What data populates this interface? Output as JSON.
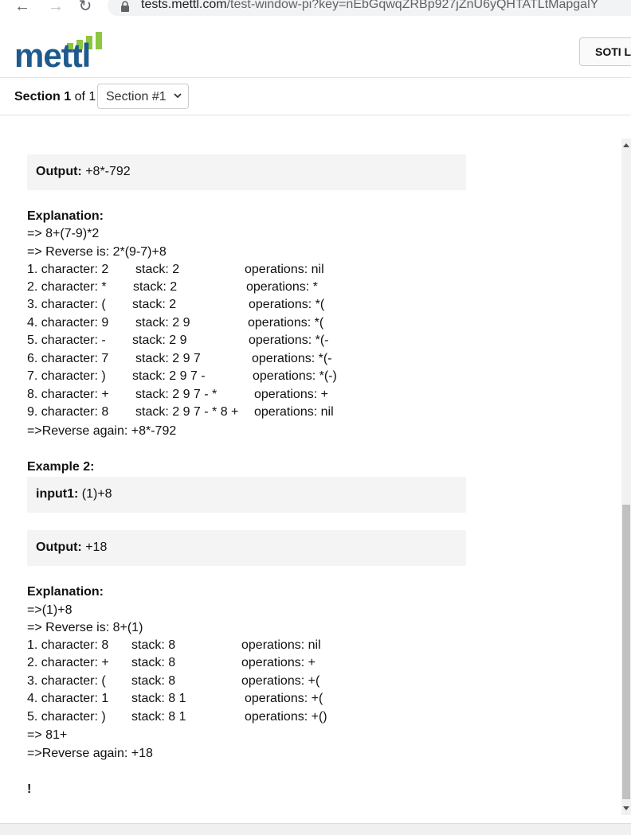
{
  "browser": {
    "back_icon": "arrow-left-icon",
    "forward_icon": "arrow-right-icon",
    "reload_icon": "reload-icon",
    "url_host": "tests.mettl.com",
    "url_path": "/test-window-pi?key=nEbGqwqZRBp927jZnU6yQHTATLtMapgalY"
  },
  "header": {
    "logo_text": "mettl",
    "user_button_label": "SOTI L",
    "brand_color": "#1e5a8d",
    "accent_color": "#8dc63f"
  },
  "section_bar": {
    "prefix": "Section",
    "current": "1",
    "of_label": "of 1",
    "selected": "Section #1"
  },
  "content": {
    "output1_label": "Output:",
    "output1_value": "+8*-792",
    "explanation1_label": "Explanation:",
    "explanation1_lines": [
      "=> 8+(7-9)*2",
      "=> Reverse is: 2*(9-7)+8"
    ],
    "steps1": [
      {
        "char": "1. character: 2",
        "stack": "stack: 2",
        "ops": "operations: nil"
      },
      {
        "char": "2. character: *",
        "stack": "stack: 2",
        "ops": "operations: *"
      },
      {
        "char": "3. character: (",
        "stack": "stack: 2",
        "ops": "operations: *("
      },
      {
        "char": "4. character: 9",
        "stack": "stack: 2 9",
        "ops": "operations: *("
      },
      {
        "char": "5. character: -",
        "stack": "stack: 2 9",
        "ops": "operations: *(-"
      },
      {
        "char": "6. character: 7",
        "stack": "stack: 2 9 7",
        "ops": "operations: *(-"
      },
      {
        "char": "7. character: )",
        "stack": "stack: 2 9 7 -",
        "ops": "operations: *(-)"
      },
      {
        "char": "8. character: +",
        "stack": "stack: 2 9 7 - *",
        "ops": "operations: +"
      },
      {
        "char": "9. character: 8",
        "stack": "stack: 2 9 7 - * 8 +",
        "ops": "operations: nil"
      }
    ],
    "reverse1": "=>Reverse again: +8*-792",
    "example2_label": "Example 2:",
    "input2_label": "input1:",
    "input2_value": "(1)+8",
    "output2_label": "Output:",
    "output2_value": "+18",
    "explanation2_label": "Explanation:",
    "explanation2_lines": [
      "=>(1)+8",
      "=> Reverse is: 8+(1)"
    ],
    "steps2": [
      {
        "char": "1. character: 8",
        "stack": "stack: 8",
        "ops": "operations: nil"
      },
      {
        "char": "2. character: +",
        "stack": "stack: 8",
        "ops": "operations: +"
      },
      {
        "char": "3. character: (",
        "stack": "stack: 8",
        "ops": "operations: +("
      },
      {
        "char": "4. character: 1",
        "stack": "stack: 8 1",
        "ops": "operations: +("
      },
      {
        "char": "5. character: )",
        "stack": "stack: 8 1",
        "ops": "operations: +()"
      }
    ],
    "result2": "=> 81+",
    "reverse2": "=>Reverse again: +18",
    "trailing": "!"
  }
}
